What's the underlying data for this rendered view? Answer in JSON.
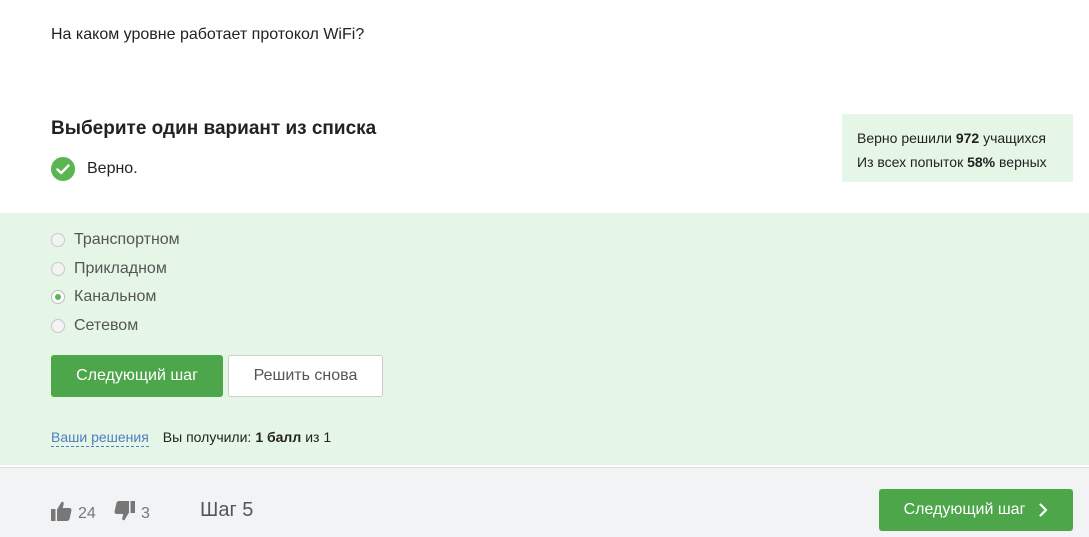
{
  "question": {
    "text": "На каком уровне работает протокол WiFi?"
  },
  "instruction": "Выберите один вариант из списка",
  "result": {
    "status_text": "Верно.",
    "icon": "check-circle-icon",
    "color": "#5ab552"
  },
  "stats": {
    "line1_prefix": "Верно решили",
    "solved_count": "972",
    "line1_suffix": "учащихся",
    "line2_prefix": "Из всех попыток",
    "correct_percent": "58%",
    "line2_suffix": "верных"
  },
  "options": [
    {
      "label": "Транспортном",
      "selected": false
    },
    {
      "label": "Прикладном",
      "selected": false
    },
    {
      "label": "Канальном",
      "selected": true
    },
    {
      "label": "Сетевом",
      "selected": false
    }
  ],
  "actions": {
    "next_label": "Следующий шаг",
    "retry_label": "Решить снова"
  },
  "score": {
    "solutions_link": "Ваши решения",
    "received_label": "Вы получили:",
    "points": "1 балл",
    "of_label": "из 1"
  },
  "footer": {
    "likes": "24",
    "dislikes": "3",
    "step_label": "Шаг 5",
    "next_label": "Следующий шаг"
  },
  "colors": {
    "accent": "#4ea64a",
    "panel_bg": "#e6f6e6",
    "link": "#4d7ec3",
    "footer_bg": "#f2f3f5"
  }
}
